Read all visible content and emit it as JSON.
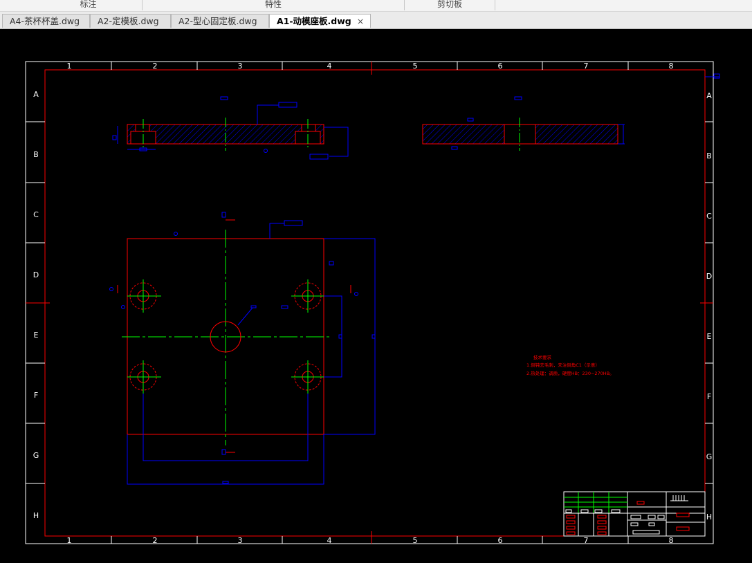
{
  "ribbon": {
    "groups": [
      "标注",
      "特性",
      "剪切板"
    ]
  },
  "tabs": [
    {
      "label": "A4-茶杯杯盖.dwg",
      "active": false
    },
    {
      "label": "A2-定模板.dwg",
      "active": false
    },
    {
      "label": "A2-型心固定板.dwg",
      "active": false
    },
    {
      "label": "A1-动模座板.dwg",
      "active": true
    }
  ],
  "tab_close_glyph": "×",
  "drawing": {
    "col_numbers": [
      "1",
      "2",
      "3",
      "4",
      "5",
      "6",
      "7",
      "8"
    ],
    "row_letters": [
      "A",
      "B",
      "C",
      "D",
      "E",
      "F",
      "G",
      "H"
    ],
    "notes": {
      "title": "技术要求",
      "line1": "1.倒钝去毛刺，未注倒角C1（示意）",
      "line2": "2.热处理：调质，硬度HB：230~270HB。"
    }
  },
  "colors": {
    "frame": "#ffffff",
    "border": "#ff0000",
    "dimension": "#0000ff",
    "centerline": "#00ff00",
    "hatch": "#0000ff"
  }
}
